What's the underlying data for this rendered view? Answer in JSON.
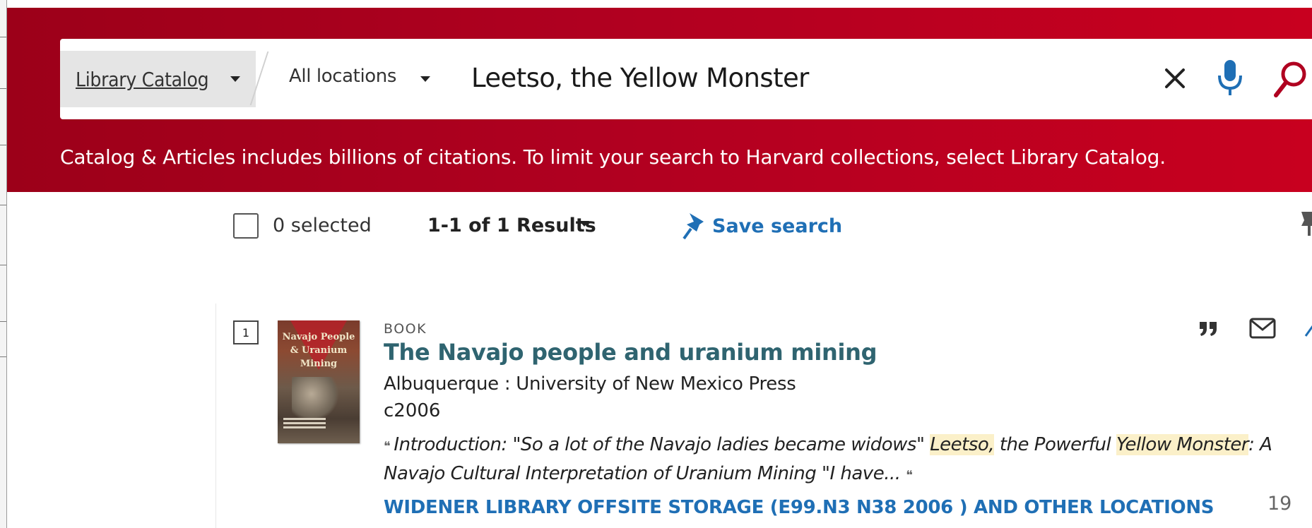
{
  "search": {
    "scope_label": "Library Catalog",
    "location_label": "All locations",
    "query": "Leetso, the Yellow Monster",
    "notice": "Catalog & Articles includes billions of citations. To limit your search to Harvard collections, select Library Catalog."
  },
  "toolbar": {
    "selected_count": "0 selected",
    "results_count": "1-1 of 1 Results",
    "save_search_label": "Save search"
  },
  "result": {
    "index": "1",
    "cover_text": "Navajo People & Uranium Mining",
    "type": "BOOK",
    "title": "The Navajo people and uranium mining",
    "publisher": "Albuquerque : University of New Mexico Press",
    "date": "c2006",
    "snippet": {
      "part1": "Introduction: \"So a lot of the Navajo ladies became widows\" ",
      "highlight1": "Leetso,",
      "part2": " the Powerful ",
      "highlight2": "Yellow Monster",
      "part3": ": A Navajo Cultural Interpretation of Uranium Mining \"I have... "
    },
    "availability": "WIDENER LIBRARY  OFFSITE STORAGE (E99.N3 N38 2006 ) AND OTHER LOCATIONS"
  },
  "slide_number": "19",
  "colors": {
    "banner": "#b00020",
    "link_blue": "#1f6fb5",
    "title_teal": "#2f6470",
    "highlight": "#fbf0c9"
  },
  "icons": [
    "close-icon",
    "microphone-icon",
    "search-icon",
    "pin-icon",
    "quote-icon",
    "mail-icon"
  ]
}
